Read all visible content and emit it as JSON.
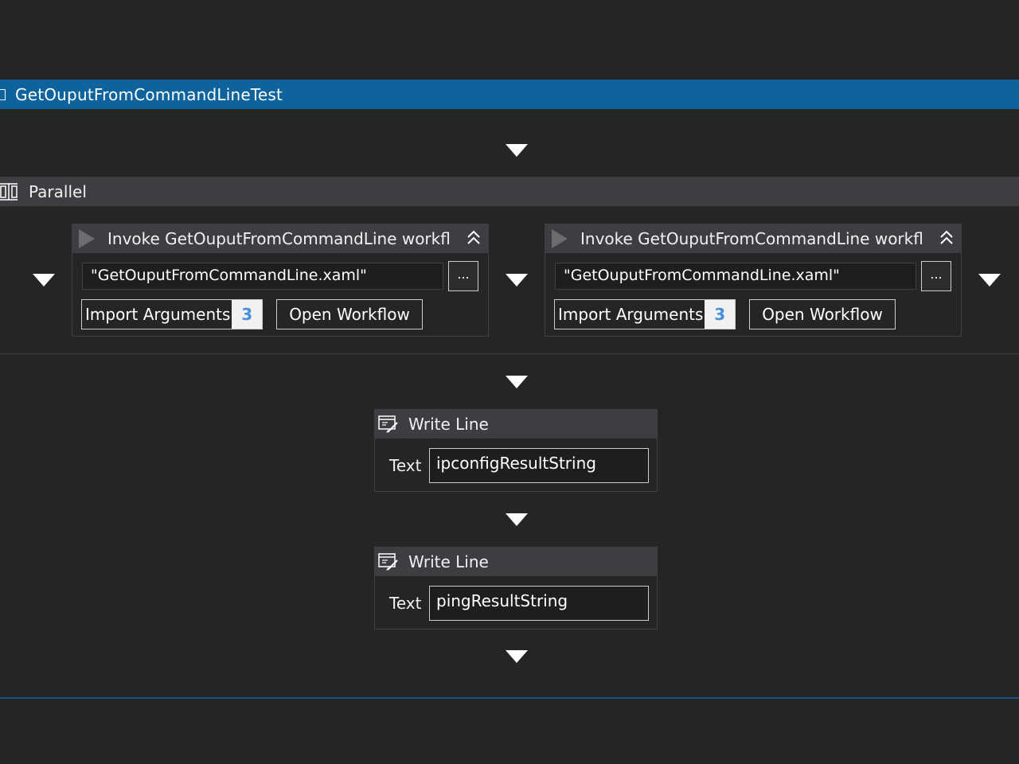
{
  "sequence": {
    "title": "GetOuputFromCommandLineTest"
  },
  "parallel": {
    "title": "Parallel"
  },
  "invoke_left": {
    "title": "Invoke GetOuputFromCommandLine workflc",
    "file": "\"GetOuputFromCommandLine.xaml\"",
    "browse_label": "...",
    "import_label": "Import Arguments",
    "import_count": "3",
    "open_label": "Open Workflow"
  },
  "invoke_right": {
    "title": "Invoke GetOuputFromCommandLine workflc",
    "file": "\"GetOuputFromCommandLine.xaml\"",
    "browse_label": "...",
    "import_label": "Import Arguments",
    "import_count": "3",
    "open_label": "Open Workflow"
  },
  "writeline_1": {
    "title": "Write Line",
    "text_label": "Text",
    "text_value": "ipconfigResultString"
  },
  "writeline_2": {
    "title": "Write Line",
    "text_label": "Text",
    "text_value": "pingResultString"
  },
  "colors": {
    "background": "#252526",
    "sequence_header": "#0e639c",
    "activity_header": "#3e3e42",
    "count_text": "#4a90d9"
  },
  "icons": {
    "sequence": "sequence-icon",
    "parallel": "parallel-icon",
    "invoke": "play-icon",
    "collapse": "double-chevron-up-icon",
    "writeline": "writeline-icon",
    "drop": "drop-arrow-icon"
  }
}
